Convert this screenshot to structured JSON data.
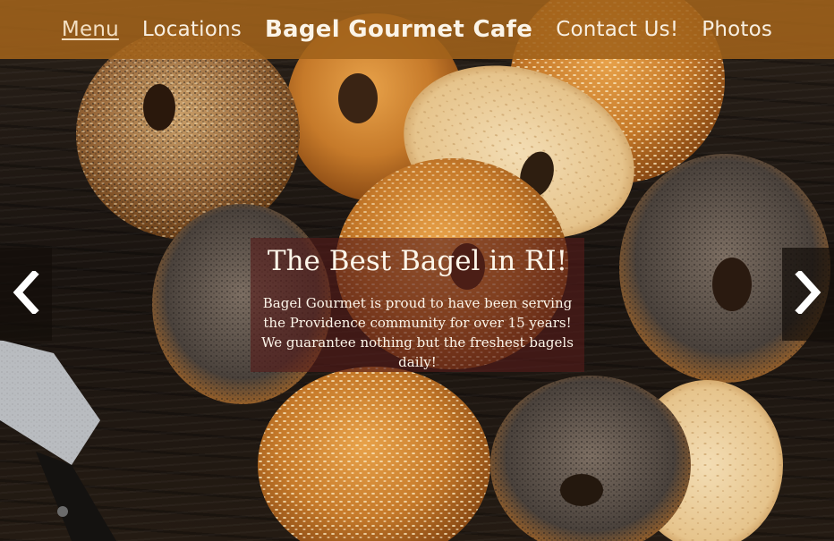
{
  "nav": {
    "left_items": [
      {
        "label": "Menu",
        "active": true
      },
      {
        "label": "Locations",
        "active": false
      }
    ],
    "brand": "Bagel Gourmet Cafe",
    "right_items": [
      {
        "label": "Contact Us!",
        "active": false
      },
      {
        "label": "Photos",
        "active": false
      }
    ]
  },
  "carousel": {
    "prev_glyph": "‹",
    "next_glyph": "›",
    "slide": {
      "title": "The Best Bagel in RI!",
      "text": "Bagel Gourmet is proud to have been serving the Providence community for over 15 years! We guarantee nothing but the freshest bagels daily!"
    }
  },
  "colors": {
    "navbar": "#a0621a",
    "caption_bg": "#561c1a",
    "text_light": "#fdf6ea",
    "wood_dark": "#1a1410"
  },
  "icons": {
    "prev": "chevron-left-icon",
    "next": "chevron-right-icon"
  }
}
